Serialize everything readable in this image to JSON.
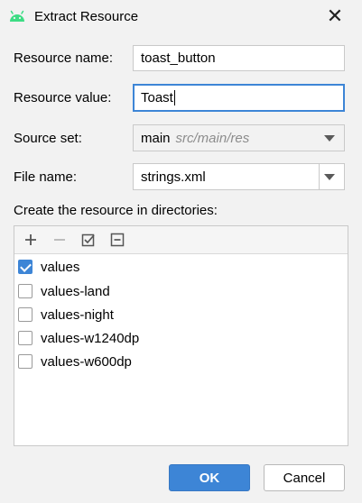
{
  "window": {
    "title": "Extract Resource",
    "icon": "android-icon",
    "accent_color": "#3d85d6"
  },
  "form": {
    "resource_name_label": "Resource name:",
    "resource_name_value": "toast_button",
    "resource_value_label": "Resource value:",
    "resource_value_value": "Toast",
    "source_set_label": "Source set:",
    "source_set_value": "main",
    "source_set_hint": "src/main/res",
    "file_name_label": "File name:",
    "file_name_value": "strings.xml"
  },
  "directories": {
    "heading": "Create the resource in directories:",
    "items": [
      {
        "label": "values",
        "checked": true
      },
      {
        "label": "values-land",
        "checked": false
      },
      {
        "label": "values-night",
        "checked": false
      },
      {
        "label": "values-w1240dp",
        "checked": false
      },
      {
        "label": "values-w600dp",
        "checked": false
      }
    ]
  },
  "buttons": {
    "ok": "OK",
    "cancel": "Cancel"
  }
}
